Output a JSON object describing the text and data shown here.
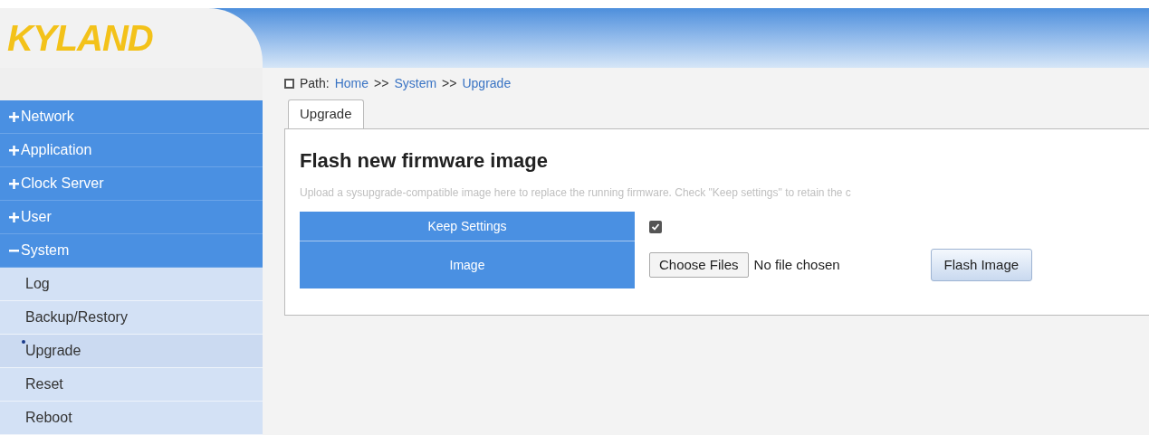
{
  "header": {
    "logo": "KYLAND"
  },
  "menu": [
    {
      "label": "Network",
      "expanded": false
    },
    {
      "label": "Application",
      "expanded": false
    },
    {
      "label": "Clock Server",
      "expanded": false
    },
    {
      "label": "User",
      "expanded": false
    },
    {
      "label": "System",
      "expanded": true,
      "children": [
        {
          "label": "Log",
          "selected": false
        },
        {
          "label": "Backup/Restory",
          "selected": false
        },
        {
          "label": "Upgrade",
          "selected": true
        },
        {
          "label": "Reset",
          "selected": false
        },
        {
          "label": "Reboot",
          "selected": false
        }
      ]
    }
  ],
  "path": {
    "label": "Path:",
    "crumbs": [
      "Home",
      ">>",
      "System",
      ">>",
      "Upgrade"
    ]
  },
  "tabs": [
    {
      "label": "Upgrade",
      "selected": true
    }
  ],
  "section": {
    "title": "Flash new firmware image",
    "description": "Upload a sysupgrade-compatible image here to replace the running firmware. Check \"Keep settings\" to retain the c"
  },
  "form": {
    "keep_settings": {
      "label": "Keep Settings",
      "checked": true
    },
    "image": {
      "label": "Image",
      "choose_button": "Choose Files",
      "file_status": "No file chosen",
      "flash_button": "Flash Image"
    }
  }
}
